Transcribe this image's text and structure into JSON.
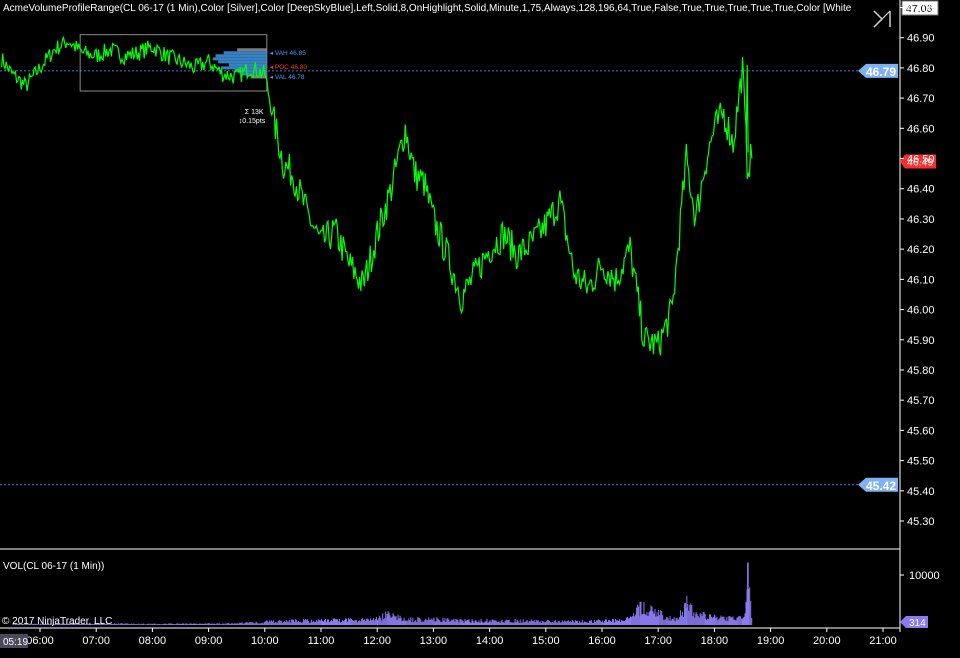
{
  "indicator_title": "AcmeVolumeProfileRange(CL 06-17 (1 Min),Color [Silver],Color [DeepSkyBlue],Left,Solid,8,OnHighlight,Solid,Minute,1,75,Always,128,196,64,True,False,True,True,True,True,True,Color [White",
  "volume_panel_title": "VOL(CL 06-17 (1 Min))",
  "copyright": "© 2017 NinjaTrader, LLC",
  "colors": {
    "background": "#000000",
    "price_line": "#00ff00",
    "volume_bars": "#8a7cf0",
    "grid_dash": "#5b6cd6",
    "axis": "#ffffff",
    "price_marker_blue": "#7eb2f5",
    "price_marker_red": "#ff2a2a",
    "vah_label": "#3aa0ff",
    "val_label": "#3aa0ff",
    "poc_label": "#ff3030"
  },
  "chart_data": [
    {
      "type": "line",
      "panel": "price",
      "x_tick_labels": [
        "05:19",
        "06:00",
        "07:00",
        "08:00",
        "09:00",
        "10:00",
        "11:00",
        "12:00",
        "13:00",
        "14:00",
        "15:00",
        "16:00",
        "17:00",
        "18:00",
        "19:00",
        "20:00",
        "21:00"
      ],
      "y_tick_labels": [
        "47.06",
        "47.00",
        "46.90",
        "46.80",
        "46.70",
        "46.60",
        "46.50",
        "46.40",
        "46.30",
        "46.20",
        "46.10",
        "46.00",
        "45.90",
        "45.80",
        "45.70",
        "45.60",
        "45.50",
        "45.40",
        "45.30"
      ],
      "ylim": [
        45.22,
        47.06
      ],
      "xlim": [
        "05:19",
        "21:15"
      ],
      "grid": false,
      "series": [
        {
          "x": [
            "05:19",
            "05:30",
            "05:45",
            "06:00",
            "06:15",
            "06:30",
            "06:45",
            "07:00",
            "07:15",
            "07:30",
            "07:45",
            "08:00",
            "08:15",
            "08:30",
            "08:45",
            "09:00",
            "09:15",
            "09:30",
            "09:45",
            "10:00",
            "10:10",
            "10:20",
            "10:30",
            "10:45",
            "11:00",
            "11:15",
            "11:30",
            "11:45",
            "12:00",
            "12:15",
            "12:30",
            "12:40",
            "12:50",
            "13:00",
            "13:15",
            "13:30",
            "13:45",
            "14:00",
            "14:15",
            "14:30",
            "14:45",
            "15:00",
            "15:15",
            "15:30",
            "15:45",
            "16:00",
            "16:15",
            "16:30",
            "16:45",
            "17:00",
            "17:15",
            "17:30",
            "17:40",
            "17:50",
            "18:00",
            "18:10",
            "18:20",
            "18:30",
            "18:35",
            "18:40"
          ],
          "values": [
            46.83,
            46.78,
            46.74,
            46.8,
            46.86,
            46.89,
            46.85,
            46.84,
            46.86,
            46.84,
            46.85,
            46.87,
            46.84,
            46.82,
            46.8,
            46.82,
            46.78,
            46.77,
            46.8,
            46.78,
            46.62,
            46.48,
            46.45,
            46.32,
            46.22,
            46.26,
            46.15,
            46.08,
            46.25,
            46.4,
            46.6,
            46.45,
            46.42,
            46.3,
            46.18,
            46.04,
            46.12,
            46.2,
            46.25,
            46.18,
            46.22,
            46.28,
            46.36,
            46.12,
            46.07,
            46.15,
            46.1,
            46.2,
            45.9,
            45.88,
            46.0,
            46.5,
            46.3,
            46.48,
            46.6,
            46.65,
            46.55,
            46.8,
            46.48,
            46.5
          ]
        }
      ],
      "horizontal_lines": [
        46.79,
        45.42
      ],
      "price_markers": [
        {
          "value": 47.06,
          "label": "47.06",
          "style": "white"
        },
        {
          "value": 46.79,
          "label": "46.79",
          "style": "blue"
        },
        {
          "value": 46.49,
          "label": "46.49",
          "style": "red"
        },
        {
          "value": 45.42,
          "label": "45.42",
          "style": "blue"
        }
      ],
      "volume_profile": {
        "time_range": [
          "06:45",
          "10:00"
        ],
        "price_range": [
          46.75,
          46.91
        ],
        "vah_label": "VAH 46.85",
        "poc_label": "POC 46.80",
        "val_label": "VAL 46.78",
        "stats_label_1": "Σ 13K",
        "stats_label_2": "↕0.15pts",
        "levels": [
          {
            "price": 46.86,
            "volume": 0.55
          },
          {
            "price": 46.85,
            "volume": 0.8
          },
          {
            "price": 46.84,
            "volume": 0.95
          },
          {
            "price": 46.83,
            "volume": 1.0
          },
          {
            "price": 46.82,
            "volume": 0.9
          },
          {
            "price": 46.81,
            "volume": 0.7
          },
          {
            "price": 46.8,
            "volume": 0.85
          },
          {
            "price": 46.79,
            "volume": 0.6
          },
          {
            "price": 46.78,
            "volume": 0.45
          },
          {
            "price": 46.77,
            "volume": 0.3
          }
        ]
      }
    },
    {
      "type": "bar",
      "panel": "volume",
      "y_tick_labels": [
        "10000"
      ],
      "current_value_label": "314",
      "ylim": [
        0,
        14000
      ],
      "series": [
        {
          "x": [
            "05:30",
            "06:00",
            "06:30",
            "07:00",
            "07:30",
            "08:00",
            "08:30",
            "09:00",
            "09:30",
            "10:00",
            "10:30",
            "11:00",
            "11:30",
            "12:00",
            "12:10",
            "12:30",
            "13:00",
            "13:30",
            "14:00",
            "14:30",
            "15:00",
            "15:30",
            "16:00",
            "16:30",
            "16:40",
            "17:00",
            "17:10",
            "17:20",
            "17:30",
            "17:40",
            "17:50",
            "18:00",
            "18:15",
            "18:25",
            "18:30",
            "18:35",
            "18:40"
          ],
          "values": [
            250,
            300,
            350,
            400,
            350,
            300,
            350,
            400,
            450,
            900,
            1200,
            1300,
            1500,
            1600,
            3000,
            1500,
            1700,
            1200,
            1300,
            1200,
            1100,
            1000,
            1200,
            1800,
            5000,
            3200,
            2000,
            1500,
            6000,
            3500,
            2500,
            2200,
            1800,
            2000,
            1500,
            12500,
            1200
          ]
        }
      ]
    }
  ]
}
